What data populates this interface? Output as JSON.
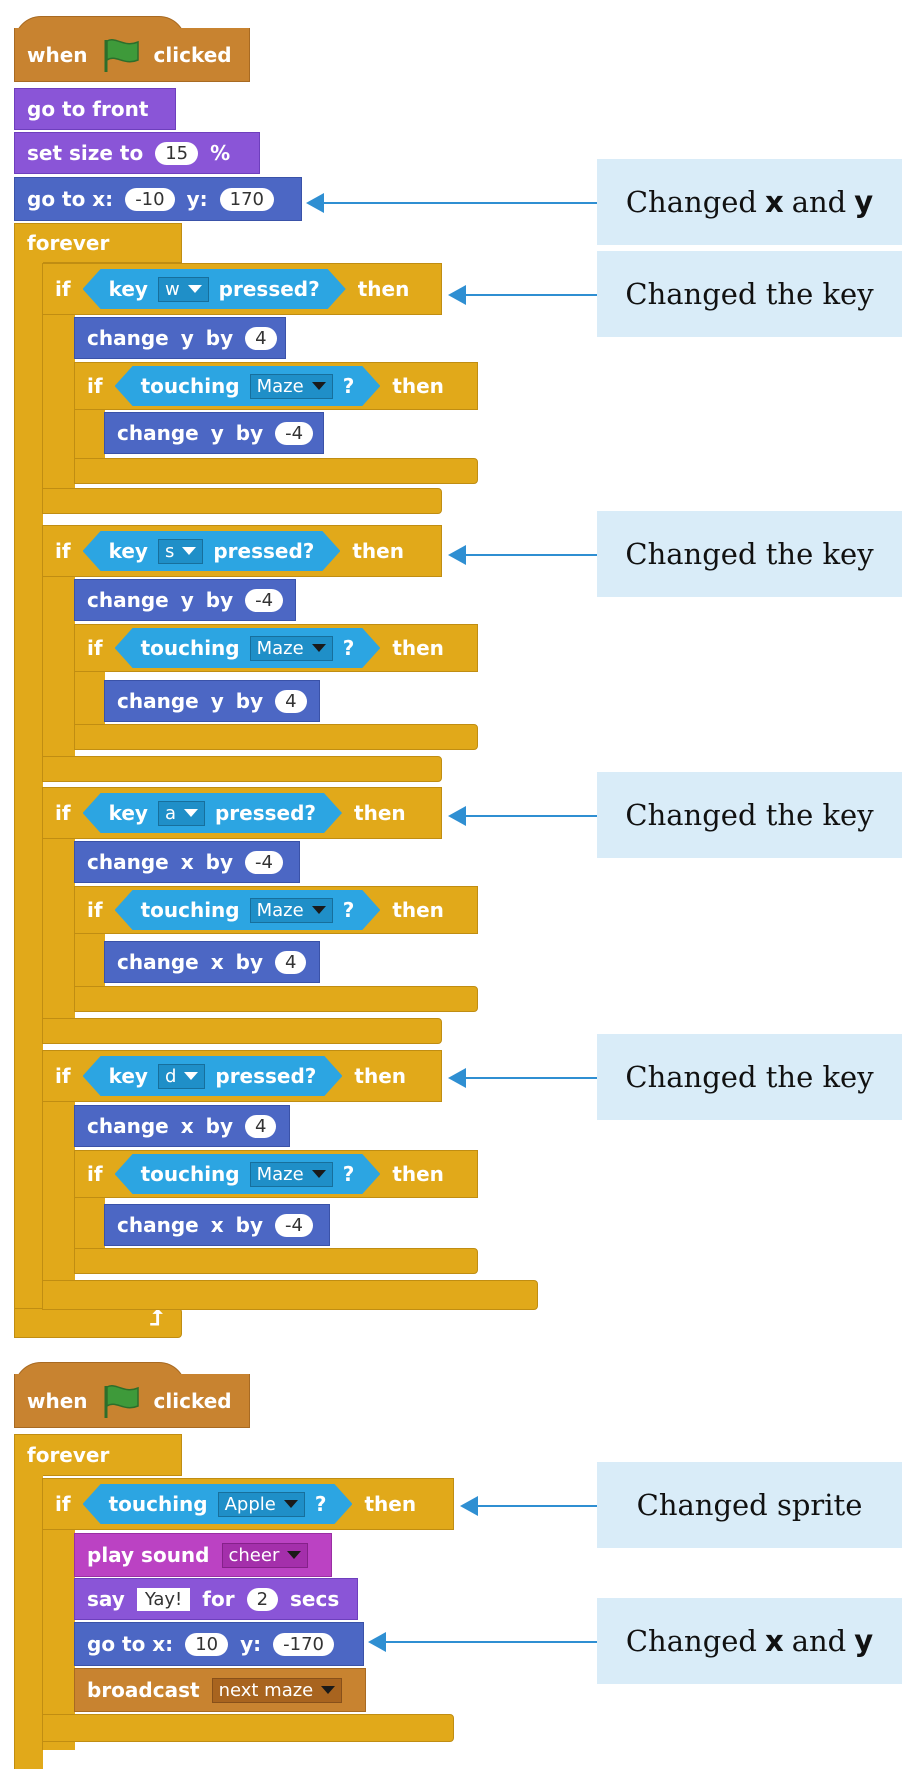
{
  "script1": {
    "when_flag": {
      "when": "when",
      "clicked": "clicked"
    },
    "go_front": "go to front",
    "set_size": {
      "label": "set size to",
      "value": "15",
      "unit": "%"
    },
    "go_to": {
      "label": "go to x:",
      "x": "-10",
      "y_label": "y:",
      "y": "170"
    },
    "forever": "forever",
    "ifs": [
      {
        "key": "w",
        "change_axis": "y",
        "change_value": "4",
        "undo_value": "-4"
      },
      {
        "key": "s",
        "change_axis": "y",
        "change_value": "-4",
        "undo_value": "4"
      },
      {
        "key": "a",
        "change_axis": "x",
        "change_value": "-4",
        "undo_value": "4"
      },
      {
        "key": "d",
        "change_axis": "x",
        "change_value": "4",
        "undo_value": "-4"
      }
    ]
  },
  "labels": {
    "if": "if",
    "then": "then",
    "key": "key",
    "pressed": "pressed?",
    "touching": "touching",
    "q": "?",
    "change": "change",
    "by": "by",
    "maze": "Maze"
  },
  "script2": {
    "when_flag": {
      "when": "when",
      "clicked": "clicked"
    },
    "forever": "forever",
    "touching_target": "Apple",
    "play_sound": {
      "label": "play sound",
      "value": "cheer"
    },
    "say": {
      "label": "say",
      "text": "Yay!",
      "for": "for",
      "secs_value": "2",
      "secs": "secs"
    },
    "go_to": {
      "label": "go to x:",
      "x": "10",
      "y_label": "y:",
      "y": "-170"
    },
    "broadcast": {
      "label": "broadcast",
      "value": "next maze"
    }
  },
  "notes": {
    "xy_pre": "Changed",
    "xy_x": "x",
    "xy_and": "and",
    "xy_y": "y",
    "key": "Changed the key",
    "sprite": "Changed sprite"
  },
  "colors": {
    "events": "#c88330",
    "looks": "#8a55d7",
    "motion": "#4c67c4",
    "control": "#e1a91a",
    "sensing": "#2ca5e2",
    "sound": "#bb42c3",
    "flag": "#3e9a3a",
    "note_bg": "#d9ecf8",
    "arrow": "#2f8fd2"
  },
  "icons": [
    "green-flag-icon",
    "dropdown-arrow-icon",
    "loop-arrow-icon"
  ]
}
